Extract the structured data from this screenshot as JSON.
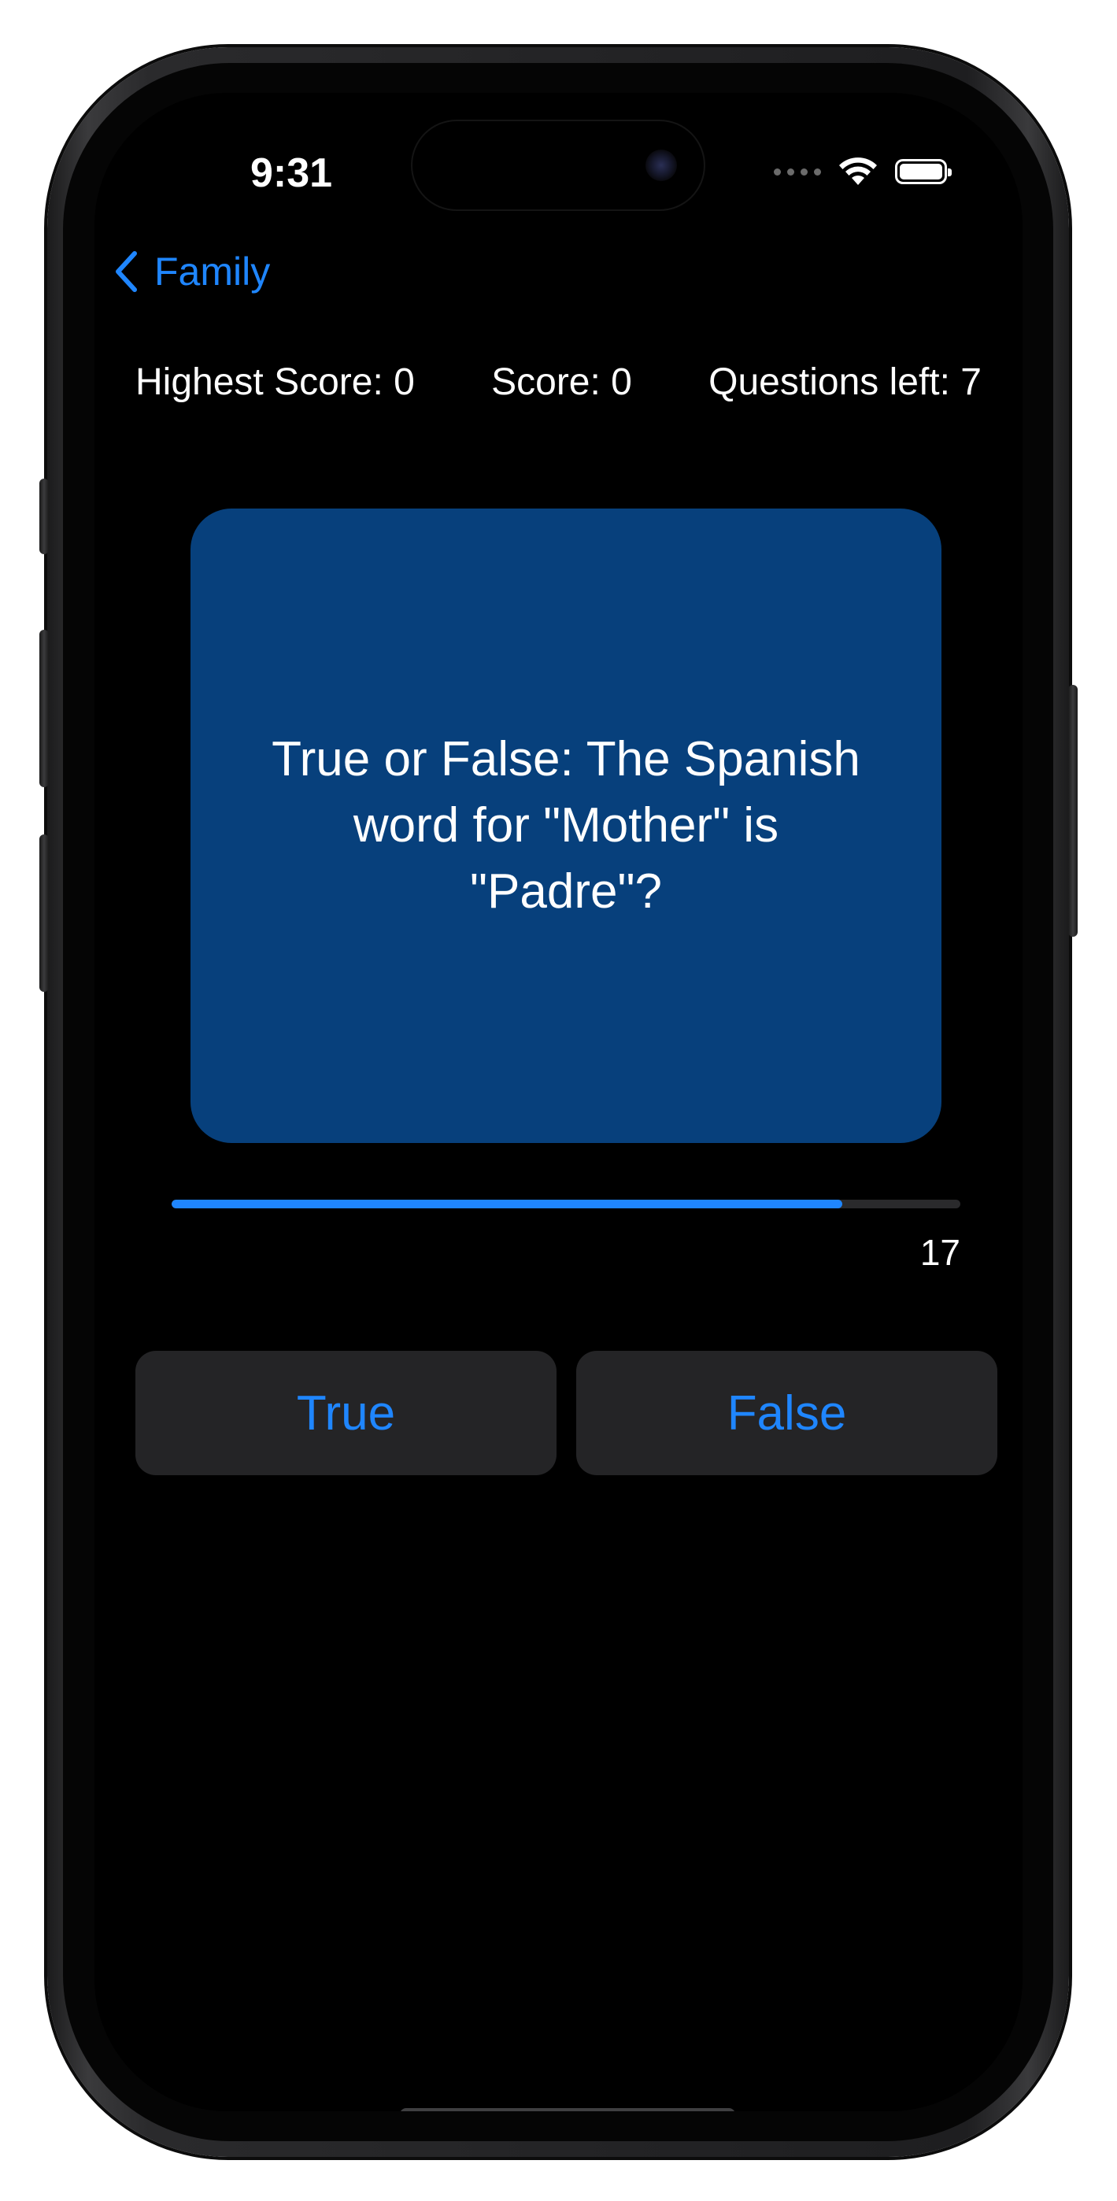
{
  "status_bar": {
    "time": "9:31",
    "icons": [
      "cellular-signal-icon",
      "wifi-icon",
      "battery-icon"
    ]
  },
  "nav": {
    "back_label": "Family",
    "back_icon": "chevron-left-icon"
  },
  "scores": {
    "highest_score": "Highest Score: 0",
    "score": "Score: 0",
    "questions_left": "Questions left: 7"
  },
  "card": {
    "question": "True or False: The Spanish word for \"Mother\" is \"Padre\"?",
    "background_color": "#07407c"
  },
  "timer": {
    "seconds_left": "17",
    "progress_fraction": 0.85
  },
  "answers": {
    "true_label": "True",
    "false_label": "False"
  },
  "colors": {
    "accent": "#1f86ff",
    "background": "#000000",
    "button_background": "#242426"
  }
}
